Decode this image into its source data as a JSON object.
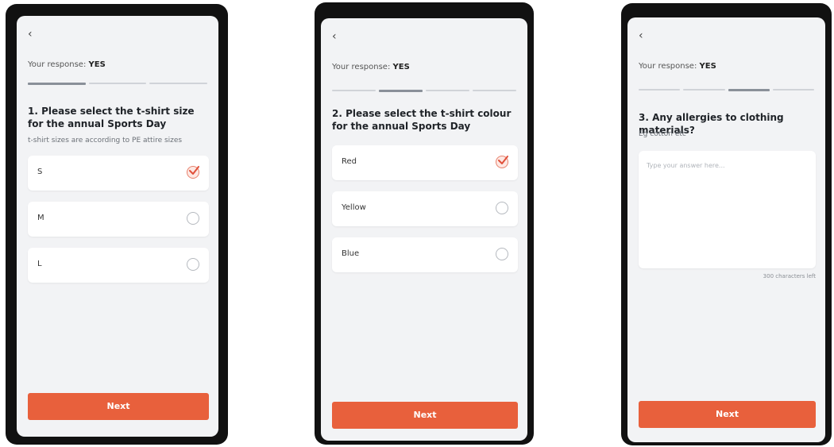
{
  "screens": [
    {
      "back_icon": "‹",
      "response_label": "Your response:",
      "response_value": "YES",
      "progress": {
        "segments": 3,
        "active": 1
      },
      "question": "1. Please select the t-shirt size for the annual Sports Day",
      "hint": "t-shirt sizes are according to PE attire sizes",
      "options": [
        {
          "label": "S",
          "selected": true
        },
        {
          "label": "M",
          "selected": false
        },
        {
          "label": "L",
          "selected": false
        }
      ],
      "next_label": "Next"
    },
    {
      "back_icon": "‹",
      "response_label": "Your response:",
      "response_value": "YES",
      "progress": {
        "segments": 4,
        "active": 2
      },
      "question": "2. Please select the t-shirt colour for the annual Sports Day",
      "options": [
        {
          "label": "Red",
          "selected": true
        },
        {
          "label": "Yellow",
          "selected": false
        },
        {
          "label": "Blue",
          "selected": false
        }
      ],
      "next_label": "Next"
    },
    {
      "back_icon": "‹",
      "response_label": "Your response:",
      "response_value": "YES",
      "progress": {
        "segments": 4,
        "active": 3
      },
      "question": "3. Any allergies to clothing materials?",
      "hint": "Eg cotton etc",
      "input_placeholder": "Type your answer here...",
      "char_counter": "300 characters left",
      "next_label": "Next"
    }
  ],
  "colors": {
    "accent": "#e8603c",
    "check": "#e8826d",
    "screen_bg": "#f2f3f5"
  },
  "icons": {
    "back": "chevron-left-icon",
    "check": "check-icon"
  }
}
